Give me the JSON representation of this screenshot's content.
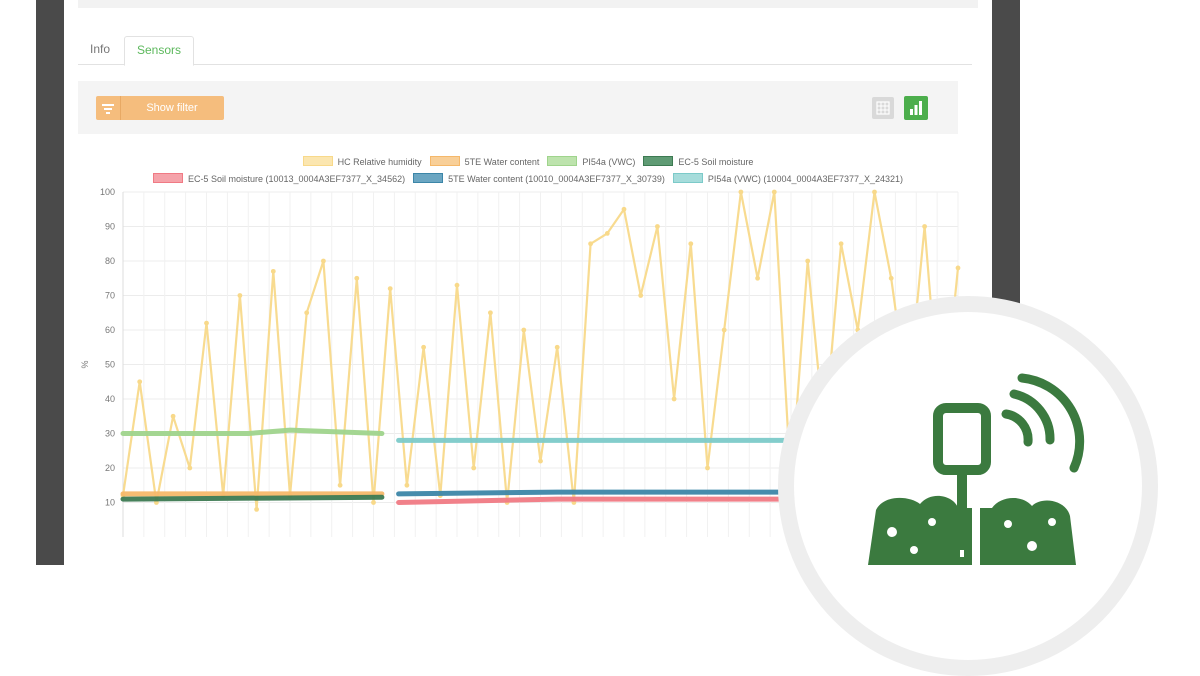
{
  "tabs": [
    {
      "label": "Info",
      "active": false
    },
    {
      "label": "Sensors",
      "active": true
    }
  ],
  "toolbar": {
    "filter_label": "Show filter",
    "filter_icon": "filter-icon",
    "table_icon": "table-view-icon",
    "chart_icon": "bar-chart-icon"
  },
  "colors": {
    "accent_green": "#4cae4c",
    "filter_orange": "#f5bd7d",
    "badge_green": "#3b7a3f"
  },
  "chart_data": {
    "type": "line",
    "ylabel": "%",
    "ylim": [
      0,
      100
    ],
    "yticks": [
      10,
      20,
      30,
      40,
      50,
      60,
      70,
      80,
      90,
      100
    ],
    "grid": true,
    "legend_position": "top",
    "series": [
      {
        "name": "HC Relative humidity",
        "color": "#f8d98a",
        "fill": "#fbe6b0",
        "x": [
          0,
          2,
          4,
          6,
          8,
          10,
          12,
          14,
          16,
          18,
          20,
          22,
          24,
          26,
          28,
          30,
          32,
          34,
          36,
          38,
          40,
          42,
          44,
          46,
          48,
          50,
          52,
          54,
          56,
          58,
          60,
          62,
          64,
          66,
          68,
          70,
          72,
          74,
          76,
          78,
          80,
          82,
          84,
          86,
          88,
          90,
          92,
          94,
          96,
          98,
          100
        ],
        "values": [
          12,
          45,
          10,
          35,
          20,
          62,
          12,
          70,
          8,
          77,
          12,
          65,
          80,
          15,
          75,
          10,
          72,
          15,
          55,
          12,
          73,
          20,
          65,
          10,
          60,
          22,
          55,
          10,
          85,
          88,
          95,
          70,
          90,
          40,
          85,
          20,
          60,
          100,
          75,
          100,
          15,
          80,
          30,
          85,
          60,
          100,
          75,
          40,
          90,
          30,
          78
        ]
      },
      {
        "name": "5TE Water content",
        "color": "#f5b86a",
        "fill": "#f8cf98",
        "x": [
          0,
          31
        ],
        "values": [
          12.5,
          12.5
        ]
      },
      {
        "name": "PI54a (VWC)",
        "color": "#9fd48c",
        "fill": "#bde3ad",
        "x": [
          0,
          15,
          20,
          31
        ],
        "values": [
          30,
          30,
          31,
          30
        ]
      },
      {
        "name": "EC-5 Soil moisture",
        "color": "#3d7a52",
        "fill": "#5f9b74",
        "x": [
          0,
          31
        ],
        "values": [
          11,
          11.5
        ]
      },
      {
        "name": "EC-5 Soil moisture (10013_0004A3EF7377_X_34562)",
        "color": "#f07a84",
        "fill": "#f5a3aa",
        "x": [
          33,
          52,
          100
        ],
        "values": [
          10,
          11,
          11
        ]
      },
      {
        "name": "5TE Water content (10010_0004A3EF7377_X_30739)",
        "color": "#3c86a8",
        "fill": "#6ba6c2",
        "x": [
          33,
          52,
          100
        ],
        "values": [
          12.5,
          13,
          13
        ]
      },
      {
        "name": "PI54a (VWC) (10004_0004A3EF7377_X_24321)",
        "color": "#7ccac9",
        "fill": "#a6dcdb",
        "x": [
          33,
          100
        ],
        "values": [
          28,
          28
        ]
      }
    ]
  }
}
